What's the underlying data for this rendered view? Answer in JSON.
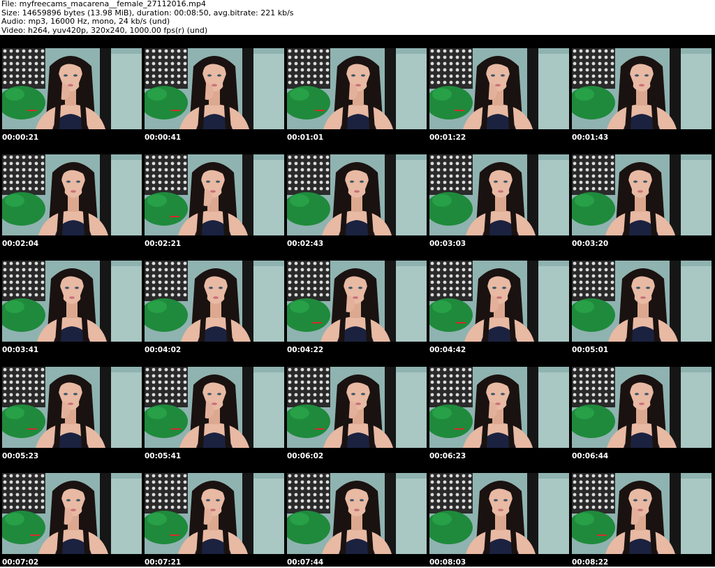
{
  "header": {
    "file": "File: myfreecams_macarena__female_27112016.mp4",
    "size": "Size: 14659896 bytes (13.98 MiB), duration: 00:08:50, avg.bitrate: 221 kb/s",
    "audio": "Audio: mp3, 16000 Hz, mono, 24 kb/s (und)",
    "video": "Video: h264, yuv420p, 320x240, 1000.00 fps(r) (und)"
  },
  "colors": {
    "background": "#000000",
    "header_text": "#000000",
    "timestamp_text": "#ffffff",
    "wall": "#8fb3b0",
    "pillow": "#1f8a3c",
    "hair": "#1a1210",
    "skin": "#e8b9a3"
  },
  "thumbnails": [
    {
      "time": "00:00:21"
    },
    {
      "time": "00:00:41"
    },
    {
      "time": "00:01:01"
    },
    {
      "time": "00:01:22"
    },
    {
      "time": "00:01:43"
    },
    {
      "time": "00:02:04"
    },
    {
      "time": "00:02:21"
    },
    {
      "time": "00:02:43"
    },
    {
      "time": "00:03:03"
    },
    {
      "time": "00:03:20"
    },
    {
      "time": "00:03:41"
    },
    {
      "time": "00:04:02"
    },
    {
      "time": "00:04:22"
    },
    {
      "time": "00:04:42"
    },
    {
      "time": "00:05:01"
    },
    {
      "time": "00:05:23"
    },
    {
      "time": "00:05:41"
    },
    {
      "time": "00:06:02"
    },
    {
      "time": "00:06:23"
    },
    {
      "time": "00:06:44"
    },
    {
      "time": "00:07:02"
    },
    {
      "time": "00:07:21"
    },
    {
      "time": "00:07:44"
    },
    {
      "time": "00:08:03"
    },
    {
      "time": "00:08:22"
    }
  ]
}
